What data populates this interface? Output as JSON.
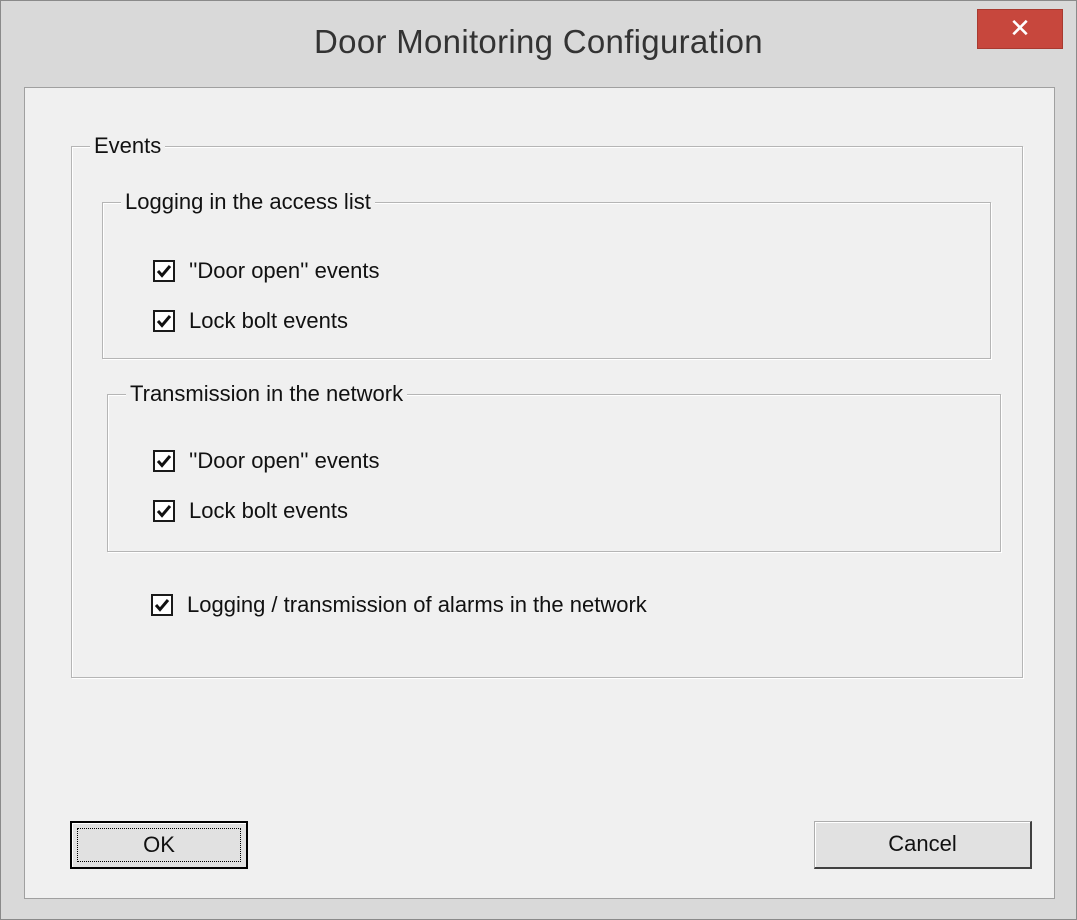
{
  "window": {
    "title": "Door Monitoring Configuration",
    "close_glyph": "✕"
  },
  "events_group": {
    "label": "Events",
    "logging_group": {
      "label": "Logging in the access list",
      "items": [
        {
          "label": "''Door open'' events",
          "checked": true
        },
        {
          "label": "Lock bolt events",
          "checked": true
        }
      ]
    },
    "transmission_group": {
      "label": "Transmission in the network",
      "items": [
        {
          "label": "''Door open'' events",
          "checked": true
        },
        {
          "label": "Lock bolt events",
          "checked": true
        }
      ]
    },
    "alarms": {
      "label": "Logging / transmission of alarms in the network",
      "checked": true
    }
  },
  "buttons": {
    "ok_label": "OK",
    "cancel_label": "Cancel"
  },
  "colors": {
    "close_button": "#c7473d",
    "dialog_background": "#f0f0f0",
    "frame": "#d9d9d9"
  }
}
